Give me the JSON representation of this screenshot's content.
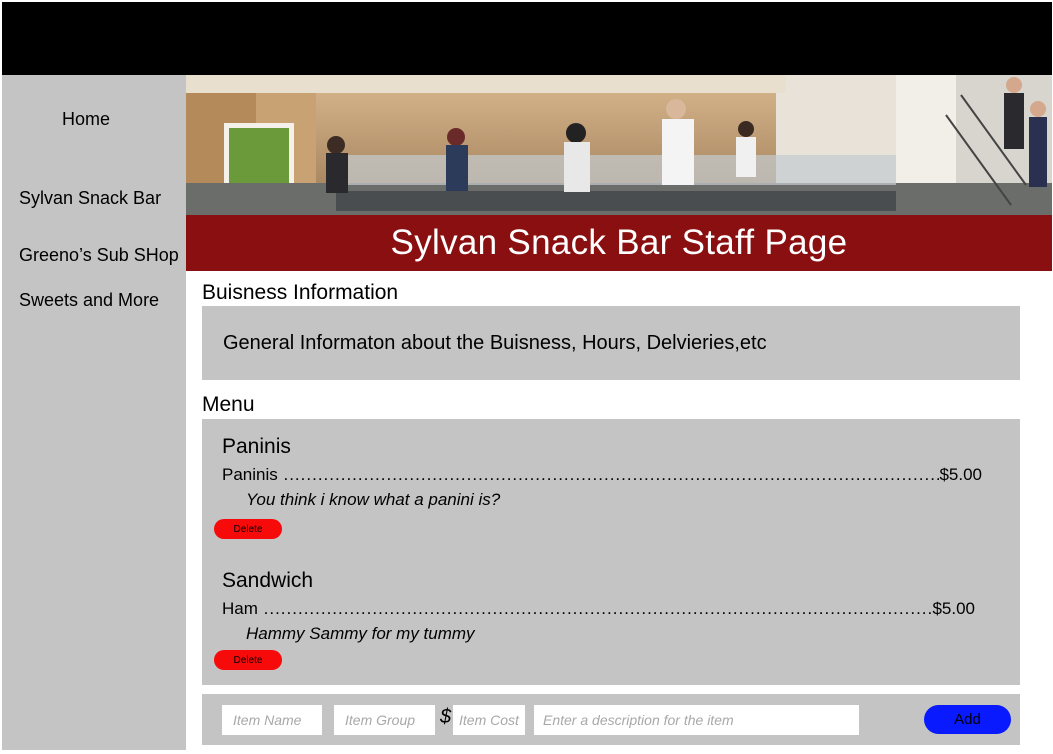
{
  "sidebar": {
    "items": [
      {
        "label": "Home"
      },
      {
        "label": "Sylvan Snack Bar"
      },
      {
        "label": "Greeno’s Sub SHop"
      },
      {
        "label": "Sweets and More"
      }
    ]
  },
  "header": {
    "title": "Sylvan Snack Bar Staff Page"
  },
  "business": {
    "heading": "Buisness Information",
    "text": "General Informaton about the Buisness, Hours, Delvieries,etc"
  },
  "menu": {
    "heading": "Menu",
    "groups": [
      {
        "name": "Paninis",
        "item_name": "Paninis",
        "price": "$5.00",
        "description": "You think i know what a  panini is?",
        "delete_label": "Delete"
      },
      {
        "name": "Sandwich",
        "item_name": "Ham",
        "price": "$5.00",
        "description": "Hammy Sammy for my tummy",
        "delete_label": "Delete"
      }
    ]
  },
  "add_form": {
    "item_name_placeholder": "Item Name",
    "item_group_placeholder": "Item Group",
    "currency_symbol": "$",
    "item_cost_placeholder": "Item Cost",
    "description_placeholder": "Enter a description for the item",
    "add_label": "Add"
  },
  "colors": {
    "title_bar": "#8a0f10",
    "delete_button": "#f70a0a",
    "add_button": "#0a1aff",
    "panel_gray": "#c4c4c4"
  }
}
